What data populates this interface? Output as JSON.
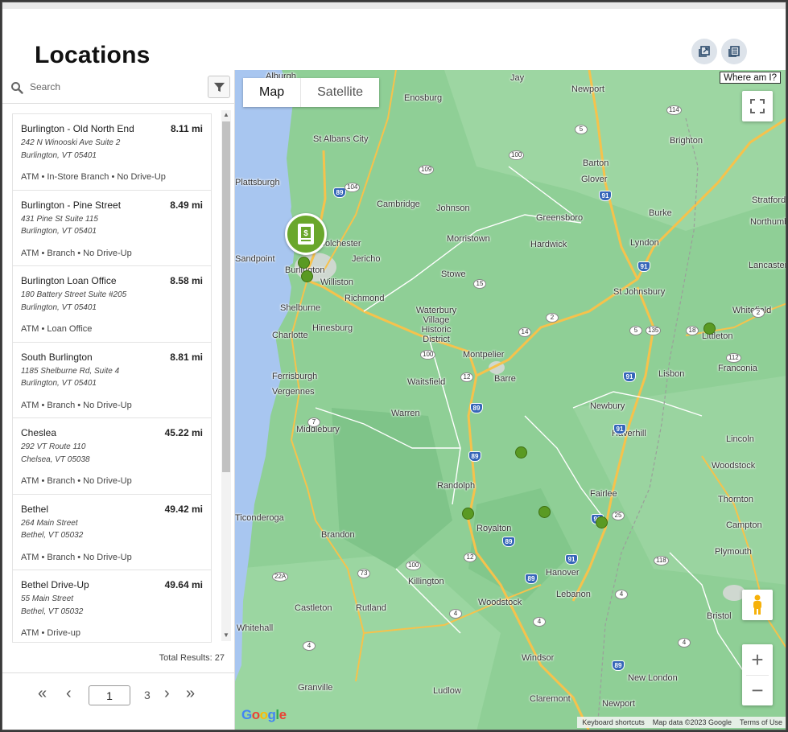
{
  "page": {
    "title": "Locations"
  },
  "header_buttons": {
    "icon_1": "export-icon",
    "icon_2": "print-list-icon"
  },
  "search": {
    "placeholder": "Search",
    "value": ""
  },
  "locations": [
    {
      "name": "Burlington - Old North End",
      "distance": "8.11 mi",
      "address1": "242 N Winooski Ave Suite 2",
      "address2": "Burlington, VT 05401",
      "services": "ATM • In-Store Branch • No Drive-Up"
    },
    {
      "name": "Burlington - Pine Street",
      "distance": "8.49 mi",
      "address1": "431 Pine St Suite 115",
      "address2": "Burlington, VT 05401",
      "services": "ATM • Branch • No Drive-Up"
    },
    {
      "name": "Burlington Loan Office",
      "distance": "8.58 mi",
      "address1": "180 Battery Street Suite #205",
      "address2": "Burlington, VT 05401",
      "services": "ATM • Loan Office"
    },
    {
      "name": "South Burlington",
      "distance": "8.81 mi",
      "address1": "1185 Shelburne Rd, Suite 4",
      "address2": "Burlington, VT 05401",
      "services": "ATM • Branch • No Drive-Up"
    },
    {
      "name": "Cheslea",
      "distance": "45.22 mi",
      "address1": "292 VT Route 110",
      "address2": "Chelsea, VT 05038",
      "services": "ATM • Branch • No Drive-Up"
    },
    {
      "name": "Bethel",
      "distance": "49.42 mi",
      "address1": "264 Main Street",
      "address2": "Bethel, VT 05032",
      "services": "ATM • Branch • No Drive-Up"
    },
    {
      "name": "Bethel Drive-Up",
      "distance": "49.64 mi",
      "address1": "55 Main Street",
      "address2": "Bethel, VT 05032",
      "services": "ATM • Drive-up"
    }
  ],
  "results": {
    "total_text": "Total Results: 27"
  },
  "pagination": {
    "first": "«",
    "prev": "‹",
    "current_page": "1",
    "total_pages": "3",
    "next": "›",
    "last": "»"
  },
  "map": {
    "type_map": "Map",
    "type_satellite": "Satellite",
    "where_am_i": "Where am I?",
    "zoom_in": "+",
    "zoom_out": "−",
    "logo": "Google",
    "keyboard_shortcuts": "Keyboard shortcuts",
    "map_data": "Map data ©2023 Google",
    "terms": "Terms of Use",
    "places": [
      "Alburgh",
      "Jay",
      "Newport",
      "Enosburg",
      "St Albans City",
      "Brighton",
      "Barton",
      "Glover",
      "Burke",
      "Stratford",
      "Northumberland",
      "Cambridge",
      "Johnson",
      "Greensboro",
      "Burlington",
      "Jericho",
      "Williston",
      "Morristown",
      "Hardwick",
      "Lyndon",
      "Lancaster",
      "Stowe",
      "Richmond",
      "Shelburne",
      "Hinesburg",
      "Charlotte",
      "Waterbury Village Historic District",
      "St Johnsbury",
      "Whitefield",
      "Littleton",
      "Franconia",
      "Montpelier",
      "Waitsfield",
      "Barre",
      "Lisbon",
      "Ferrisburgh",
      "Vergennes",
      "Warren",
      "Newbury",
      "Haverhill",
      "Lincoln",
      "Woodstock",
      "Middlebury",
      "Randolph",
      "Fairlee",
      "Thornton",
      "Brandon",
      "Royalton",
      "Campton",
      "Plymouth",
      "Hanover",
      "Killington",
      "Lebanon",
      "Woodstock",
      "Castleton",
      "Rutland",
      "Bristol",
      "Whitehall",
      "Windsor",
      "New London",
      "Granville",
      "Ludlow",
      "Claremont",
      "Newport",
      "Ticonderoga",
      "Plattsburgh",
      "Colchester",
      "Sandpoint"
    ],
    "colors": {
      "land": "#8fcf96",
      "water": "#a8c6f0",
      "marker": "#5a9a23",
      "road": "#f6c24c"
    }
  }
}
